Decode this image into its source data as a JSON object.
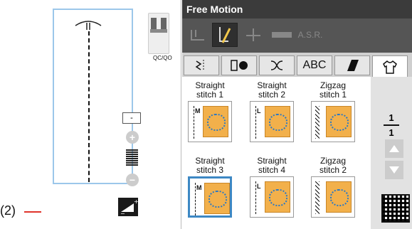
{
  "annotation": {
    "label": "(2)",
    "line_color": "#e0342b"
  },
  "left_panel": {
    "foot_label": "QC/QO",
    "stitch_length_minus": "-",
    "plus_symbol": "+",
    "minus_symbol": "−",
    "tension_button_icon": "tension-icon"
  },
  "right_panel": {
    "title": "Free Motion",
    "modes": [
      {
        "icon": "presser-foot-mode-icon",
        "active": false
      },
      {
        "icon": "free-motion-mode-icon",
        "active": true
      },
      {
        "icon": "needle-mode-icon",
        "active": false
      },
      {
        "icon": "ruler-mode-icon",
        "active": false
      },
      {
        "label": "A.S.R.",
        "active": false
      }
    ],
    "categories": [
      {
        "icon": "utility-stitch-icon",
        "active": false
      },
      {
        "icon": "buttonhole-icon",
        "active": false
      },
      {
        "icon": "decorative-stitch-icon",
        "active": false
      },
      {
        "label": "ABC",
        "active": false
      },
      {
        "icon": "quilting-icon",
        "active": false
      },
      {
        "icon": "garment-icon",
        "active": true
      }
    ],
    "stitches": [
      {
        "label_line1": "Straight",
        "label_line2": "stitch 1",
        "mark": "M",
        "type": "straight",
        "selected": false
      },
      {
        "label_line1": "Straight",
        "label_line2": "stitch 2",
        "mark": "L",
        "type": "straight",
        "selected": false
      },
      {
        "label_line1": "Zigzag",
        "label_line2": "stitch 1",
        "mark": "",
        "type": "zigzag",
        "selected": false
      },
      {
        "label_line1": "Straight",
        "label_line2": "stitch 3",
        "mark": "M",
        "type": "straight",
        "selected": true
      },
      {
        "label_line1": "Straight",
        "label_line2": "stitch 4",
        "mark": "L",
        "type": "straight",
        "selected": false
      },
      {
        "label_line1": "Zigzag",
        "label_line2": "stitch 2",
        "mark": "",
        "type": "zigzag",
        "selected": false
      }
    ],
    "page": {
      "current": "1",
      "total": "1"
    },
    "colors": {
      "fabric": "#f2b04b",
      "flower": "#2a78c4",
      "selected": "#3d88c4"
    }
  }
}
